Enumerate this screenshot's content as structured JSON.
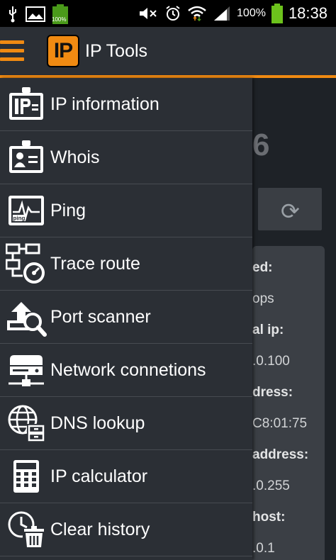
{
  "status_bar": {
    "battery_small": "100%",
    "battery_percent": "100%",
    "time": "18:38"
  },
  "app_bar": {
    "logo_text": "IP",
    "title": "IP Tools"
  },
  "background": {
    "big_text": "6",
    "refresh_icon": "refresh-icon",
    "lines": [
      {
        "text": "ed:",
        "bold": true
      },
      {
        "text": "ops",
        "bold": false
      },
      {
        "text": "al ip:",
        "bold": true
      },
      {
        "text": ".0.100",
        "bold": false
      },
      {
        "text": "dress:",
        "bold": true
      },
      {
        "text": "C8:01:75",
        "bold": false
      },
      {
        "text": "address:",
        "bold": true
      },
      {
        "text": ".0.255",
        "bold": false
      },
      {
        "text": "host:",
        "bold": true
      },
      {
        "text": ".0.1",
        "bold": false
      }
    ]
  },
  "drawer": {
    "items": [
      {
        "label": "IP information",
        "icon": "ip-badge-icon"
      },
      {
        "label": "Whois",
        "icon": "whois-badge-icon"
      },
      {
        "label": "Ping",
        "icon": "ping-monitor-icon"
      },
      {
        "label": "Trace route",
        "icon": "trace-route-icon"
      },
      {
        "label": "Port scanner",
        "icon": "port-scanner-icon"
      },
      {
        "label": "Network connetions",
        "icon": "network-connections-icon"
      },
      {
        "label": "DNS lookup",
        "icon": "dns-lookup-icon"
      },
      {
        "label": "IP calculator",
        "icon": "calculator-icon"
      },
      {
        "label": "Clear history",
        "icon": "clear-history-icon"
      }
    ]
  },
  "colors": {
    "accent": "#f08a12",
    "drawer_bg": "#2b2f35",
    "divider": "#474b51"
  }
}
